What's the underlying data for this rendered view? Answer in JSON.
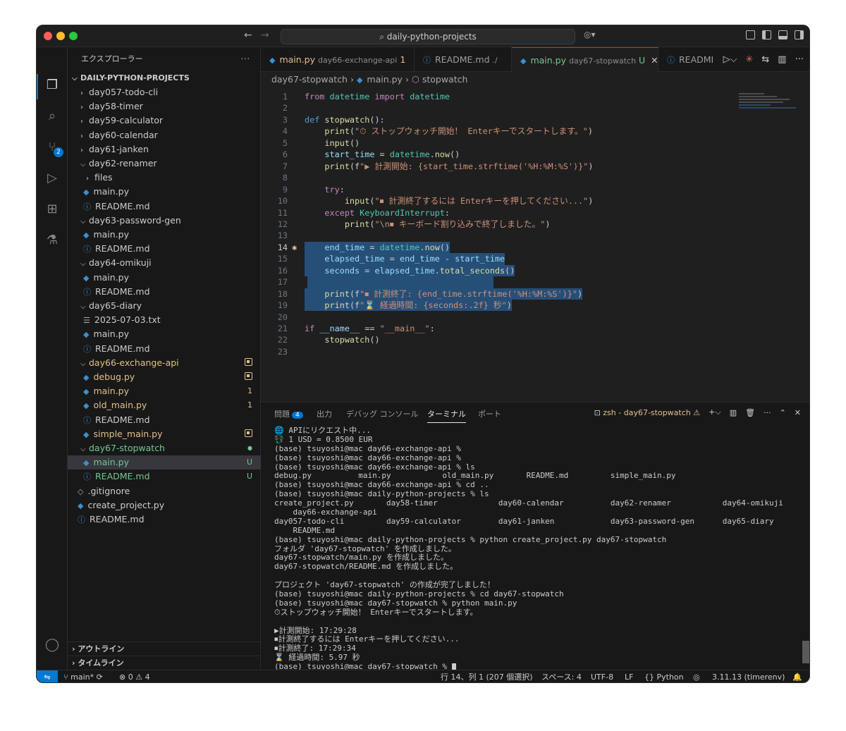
{
  "titlebar": {
    "search": "daily-python-projects"
  },
  "activity": {
    "scm_badge": "2"
  },
  "explorer": {
    "title": "エクスプローラー",
    "more": "···",
    "root": "DAILY-PYTHON-PROJECTS",
    "rows": [
      {
        "label": "day057-todo-cli",
        "kind": "folder",
        "open": false
      },
      {
        "label": "day58-timer",
        "kind": "folder",
        "open": false
      },
      {
        "label": "day59-calculator",
        "kind": "folder",
        "open": false
      },
      {
        "label": "day60-calendar",
        "kind": "folder",
        "open": false
      },
      {
        "label": "day61-janken",
        "kind": "folder",
        "open": false
      },
      {
        "label": "day62-renamer",
        "kind": "folder",
        "open": true
      },
      {
        "label": "files",
        "kind": "folder",
        "open": false,
        "depth": 2
      },
      {
        "label": "main.py",
        "kind": "py",
        "depth": 2
      },
      {
        "label": "README.md",
        "kind": "info",
        "depth": 2
      },
      {
        "label": "day63-password-gen",
        "kind": "folder",
        "open": true
      },
      {
        "label": "main.py",
        "kind": "py",
        "depth": 2
      },
      {
        "label": "README.md",
        "kind": "info",
        "depth": 2
      },
      {
        "label": "day64-omikuji",
        "kind": "folder",
        "open": true
      },
      {
        "label": "main.py",
        "kind": "py",
        "depth": 2
      },
      {
        "label": "README.md",
        "kind": "info",
        "depth": 2
      },
      {
        "label": "day65-diary",
        "kind": "folder",
        "open": true
      },
      {
        "label": "2025-07-03.txt",
        "kind": "txt",
        "depth": 2
      },
      {
        "label": "main.py",
        "kind": "py",
        "depth": 2
      },
      {
        "label": "README.md",
        "kind": "info",
        "depth": 2
      },
      {
        "label": "day66-exchange-api",
        "kind": "folder",
        "open": true,
        "color": "mod",
        "badge": "sq"
      },
      {
        "label": "debug.py",
        "kind": "py",
        "depth": 2,
        "color": "mod",
        "badge": "sq"
      },
      {
        "label": "main.py",
        "kind": "py",
        "depth": 2,
        "color": "mod",
        "badge": "1"
      },
      {
        "label": "old_main.py",
        "kind": "py",
        "depth": 2,
        "color": "mod",
        "badge": "1"
      },
      {
        "label": "README.md",
        "kind": "info",
        "depth": 2
      },
      {
        "label": "simple_main.py",
        "kind": "py",
        "depth": 2,
        "color": "mod",
        "badge": "sq"
      },
      {
        "label": "day67-stopwatch",
        "kind": "folder",
        "open": true,
        "color": "untr",
        "badge": "dot"
      },
      {
        "label": "main.py",
        "kind": "py",
        "depth": 2,
        "color": "untr",
        "badge": "U",
        "selected": true
      },
      {
        "label": "README.md",
        "kind": "info",
        "depth": 2,
        "color": "untr",
        "badge": "U"
      },
      {
        "label": ".gitignore",
        "kind": "git",
        "depth": 1
      },
      {
        "label": "create_project.py",
        "kind": "py",
        "depth": 1
      },
      {
        "label": "README.md",
        "kind": "info",
        "depth": 1
      }
    ],
    "outline": "アウトライン",
    "timeline": "タイムライン"
  },
  "tabs": [
    {
      "label": "main.py",
      "desc": "day66-exchange-api",
      "extra": "1",
      "color": "mod"
    },
    {
      "label": "README.md",
      "desc": "./",
      "color": ""
    },
    {
      "label": "main.py",
      "desc": "day67-stopwatch",
      "extra": "U",
      "color": "untr",
      "active": true
    },
    {
      "label": "READMI",
      "desc": "",
      "color": ""
    }
  ],
  "breadcrumb": {
    "folder": "day67-stopwatch",
    "file": "main.py",
    "symbol": "stopwatch"
  },
  "editor": {
    "current_line": 14,
    "lines": [
      "from datetime import datetime",
      "",
      "def stopwatch():",
      "    print(\"⏱ ストップウォッチ開始！ Enterキーでスタートします。\")",
      "    input()",
      "    start_time = datetime.now()",
      "    print(f\"▶ 計測開始: {start_time.strftime('%H:%M:%S')}\")",
      "",
      "    try:",
      "        input(\"⏹ 計測終了するには Enterキーを押してください...\")",
      "    except KeyboardInterrupt:",
      "        print(\"\\n⏹ キーボード割り込みで終了しました。\")",
      "",
      "    end_time = datetime.now()",
      "    elapsed_time = end_time - start_time",
      "    seconds = elapsed_time.total_seconds()",
      "",
      "    print(f\"⏹ 計測終了: {end_time.strftime('%H:%M:%S')}\")",
      "    print(f\"⌛ 経過時間: {seconds:.2f} 秒\")",
      "",
      "if __name__ == \"__main__\":",
      "    stopwatch()",
      ""
    ]
  },
  "panel": {
    "tabs": [
      "問題",
      "出力",
      "デバッグ コンソール",
      "ターミナル",
      "ポート"
    ],
    "problems_count": "4",
    "terminal_name": "zsh - day67-stopwatch",
    "terminal_lines": [
      "🌐 APIにリクエスト中...",
      "💱 1 USD = 0.8500 EUR",
      "(base) tsuyoshi@mac day66-exchange-api %",
      "(base) tsuyoshi@mac day66-exchange-api %",
      "(base) tsuyoshi@mac day66-exchange-api % ls",
      "debug.py          main.py           old_main.py       README.md         simple_main.py",
      "(base) tsuyoshi@mac day66-exchange-api % cd ..",
      "(base) tsuyoshi@mac daily-python-projects % ls",
      "create_project.py       day58-timer             day60-calendar          day62-renamer           day64-omikuji",
      "    day66-exchange-api",
      "day057-todo-cli         day59-calculator        day61-janken            day63-password-gen      day65-diary",
      "    README.md",
      "(base) tsuyoshi@mac daily-python-projects % python create_project.py day67-stopwatch",
      "フォルダ 'day67-stopwatch' を作成しました。",
      "day67-stopwatch/main.py を作成しました。",
      "day67-stopwatch/README.md を作成しました。",
      "",
      "プロジェクト 'day67-stopwatch' の作成が完了しました！",
      "(base) tsuyoshi@mac daily-python-projects % cd day67-stopwatch",
      "(base) tsuyoshi@mac day67-stopwatch % python main.py",
      "⏱ストップウォッチ開始！ Enterキーでスタートします。",
      "",
      "▶計測開始: 17:29:28",
      "⏹計測終了するには Enterキーを押してください...",
      "⏹計測終了: 17:29:34",
      "⌛ 経過時間: 5.97 秒",
      "(base) tsuyoshi@mac day67-stopwatch %"
    ]
  },
  "status": {
    "branch": "main*",
    "errors": "0",
    "warnings": "4",
    "position": "行 14、列 1 (207 個選択)",
    "spaces": "スペース: 4",
    "encoding": "UTF-8",
    "eol": "LF",
    "language": "Python",
    "interpreter": "3.11.13 (timerenv)"
  },
  "colors": {
    "accent": "#0078d4",
    "modified": "#e2c08d",
    "untracked": "#73c991"
  }
}
